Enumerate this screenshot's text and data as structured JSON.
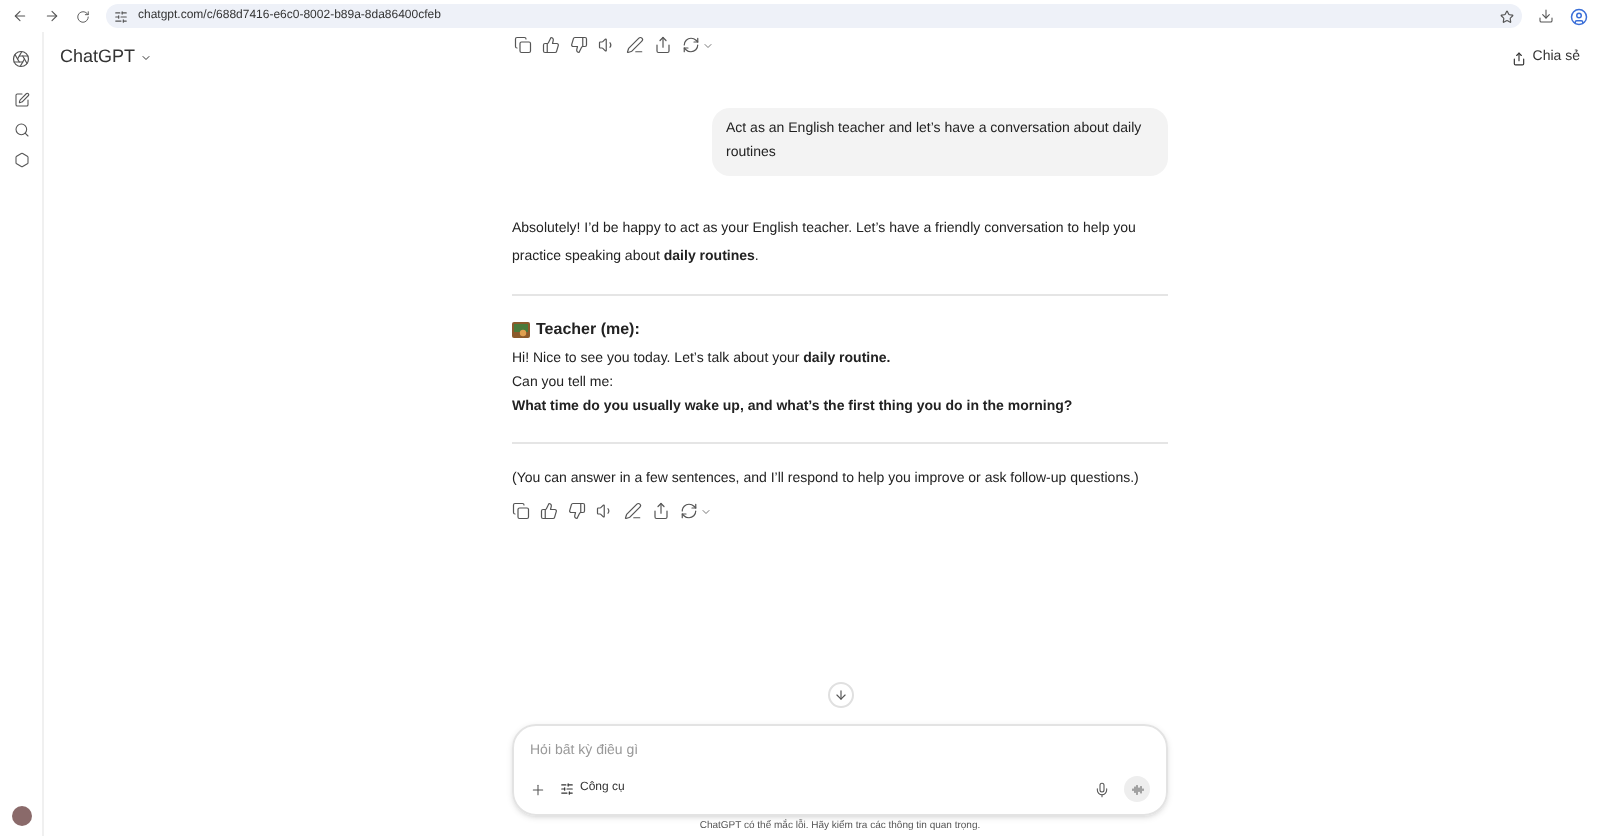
{
  "browser": {
    "url": "chatgpt.com/c/688d7416-e6c0-8002-b89a-8da86400cfeb"
  },
  "header": {
    "title": "ChatGPT",
    "share_label": "Chia sẻ"
  },
  "messages": [
    {
      "kind": "user",
      "text": "Act as an English teacher and let’s have a conversation about daily routines"
    },
    {
      "kind": "assistant",
      "blocks": [
        {
          "kind": "paragraph",
          "text": "Absolutely! I’d be happy to act as your English teacher. Let’s have a friendly conversation to help you practice speaking about **daily routines**."
        },
        {
          "kind": "divider"
        },
        {
          "kind": "heading",
          "text": "Teacher (me):"
        },
        {
          "kind": "line",
          "text": "Hi! Nice to see you today. Let’s talk about your **daily routine.**"
        },
        {
          "kind": "line",
          "text": "Can you tell me:"
        },
        {
          "kind": "strong",
          "text": "What time do you usually wake up, and what’s the first thing you do in the morning?"
        },
        {
          "kind": "divider"
        },
        {
          "kind": "paragraph",
          "text": "(You can answer in a few sentences, and I’ll respond to help you improve or ask follow-up questions.)"
        }
      ]
    }
  ],
  "composer": {
    "placeholder": "Hỏi bất kỳ điều gì",
    "tools_label": "Công cụ"
  },
  "footer": "ChatGPT có thể mắc lỗi. Hãy kiểm tra các thông tin quan trọng."
}
